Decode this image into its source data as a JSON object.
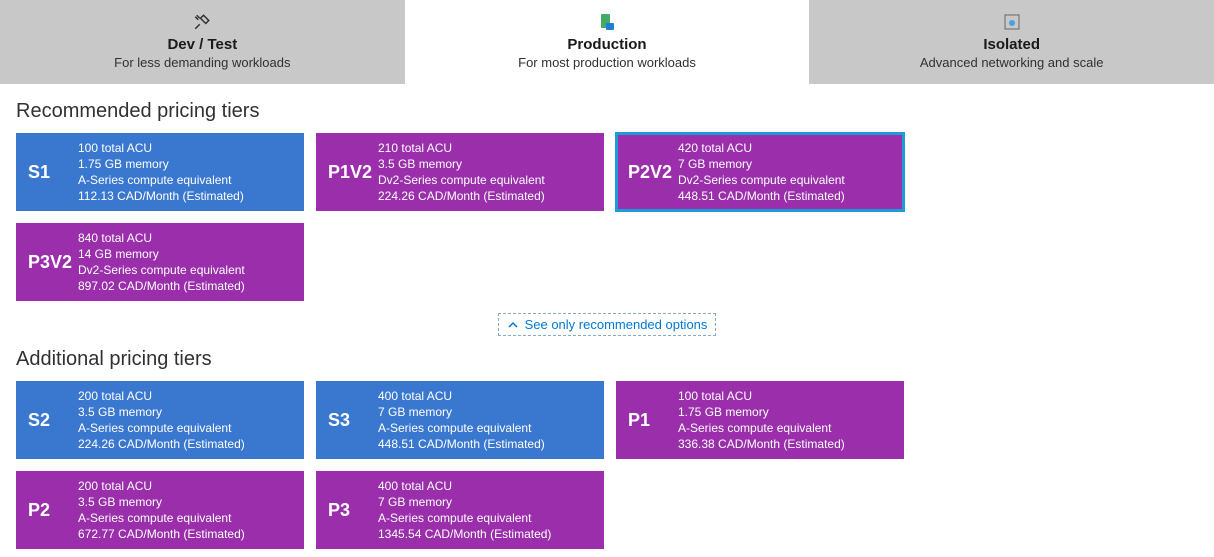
{
  "tabs": [
    {
      "title": "Dev / Test",
      "subtitle": "For less demanding workloads"
    },
    {
      "title": "Production",
      "subtitle": "For most production workloads"
    },
    {
      "title": "Isolated",
      "subtitle": "Advanced networking and scale"
    }
  ],
  "sections": {
    "recommended_title": "Recommended pricing tiers",
    "additional_title": "Additional pricing tiers"
  },
  "toggle_label": "See only recommended options",
  "recommended": [
    {
      "code": "S1",
      "color": "blue",
      "acu": "100 total ACU",
      "mem": "1.75 GB memory",
      "series": "A-Series compute equivalent",
      "price": "112.13 CAD/Month (Estimated)"
    },
    {
      "code": "P1V2",
      "color": "purple",
      "acu": "210 total ACU",
      "mem": "3.5 GB memory",
      "series": "Dv2-Series compute equivalent",
      "price": "224.26 CAD/Month (Estimated)"
    },
    {
      "code": "P2V2",
      "color": "purple",
      "acu": "420 total ACU",
      "mem": "7 GB memory",
      "series": "Dv2-Series compute equivalent",
      "price": "448.51 CAD/Month (Estimated)",
      "selected": true
    },
    {
      "code": "P3V2",
      "color": "purple",
      "acu": "840 total ACU",
      "mem": "14 GB memory",
      "series": "Dv2-Series compute equivalent",
      "price": "897.02 CAD/Month (Estimated)"
    }
  ],
  "additional": [
    {
      "code": "S2",
      "color": "blue",
      "acu": "200 total ACU",
      "mem": "3.5 GB memory",
      "series": "A-Series compute equivalent",
      "price": "224.26 CAD/Month (Estimated)"
    },
    {
      "code": "S3",
      "color": "blue",
      "acu": "400 total ACU",
      "mem": "7 GB memory",
      "series": "A-Series compute equivalent",
      "price": "448.51 CAD/Month (Estimated)"
    },
    {
      "code": "P1",
      "color": "purple",
      "acu": "100 total ACU",
      "mem": "1.75 GB memory",
      "series": "A-Series compute equivalent",
      "price": "336.38 CAD/Month (Estimated)"
    },
    {
      "code": "P2",
      "color": "purple",
      "acu": "200 total ACU",
      "mem": "3.5 GB memory",
      "series": "A-Series compute equivalent",
      "price": "672.77 CAD/Month (Estimated)"
    },
    {
      "code": "P3",
      "color": "purple",
      "acu": "400 total ACU",
      "mem": "7 GB memory",
      "series": "A-Series compute equivalent",
      "price": "1345.54 CAD/Month (Estimated)"
    }
  ]
}
